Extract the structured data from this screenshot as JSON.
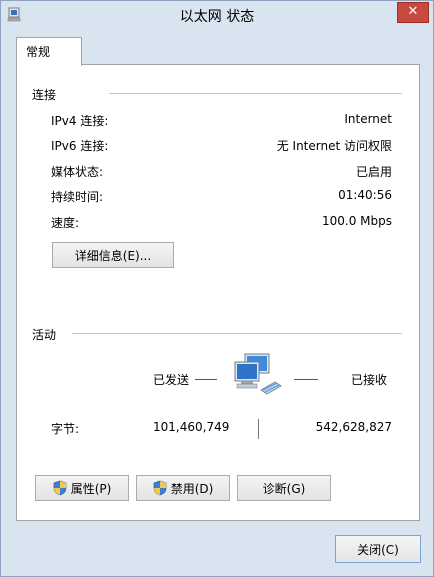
{
  "window": {
    "title": "以太网 状态",
    "close_glyph": "✕"
  },
  "tabs": [
    {
      "label": "常规"
    }
  ],
  "connection": {
    "section_label": "连接",
    "rows": [
      {
        "label": "IPv4 连接:",
        "value": "Internet"
      },
      {
        "label": "IPv6 连接:",
        "value": "无 Internet 访问权限"
      },
      {
        "label": "媒体状态:",
        "value": "已启用"
      },
      {
        "label": "持续时间:",
        "value": "01:40:56"
      },
      {
        "label": "速度:",
        "value": "100.0 Mbps"
      }
    ],
    "details_button": "详细信息(E)..."
  },
  "activity": {
    "section_label": "活动",
    "sent_label": "已发送",
    "received_label": "已接收",
    "bytes_label": "字节:",
    "bytes_sent": "101,460,749",
    "bytes_received": "542,628,827",
    "icon": "network-computers-icon"
  },
  "buttons": {
    "properties": "属性(P)",
    "disable": "禁用(D)",
    "diagnose": "诊断(G)",
    "close": "关闭(C)"
  },
  "colors": {
    "frame": "#d9e4f1",
    "close_red": "#c74a3f",
    "panel": "#ffffff"
  }
}
